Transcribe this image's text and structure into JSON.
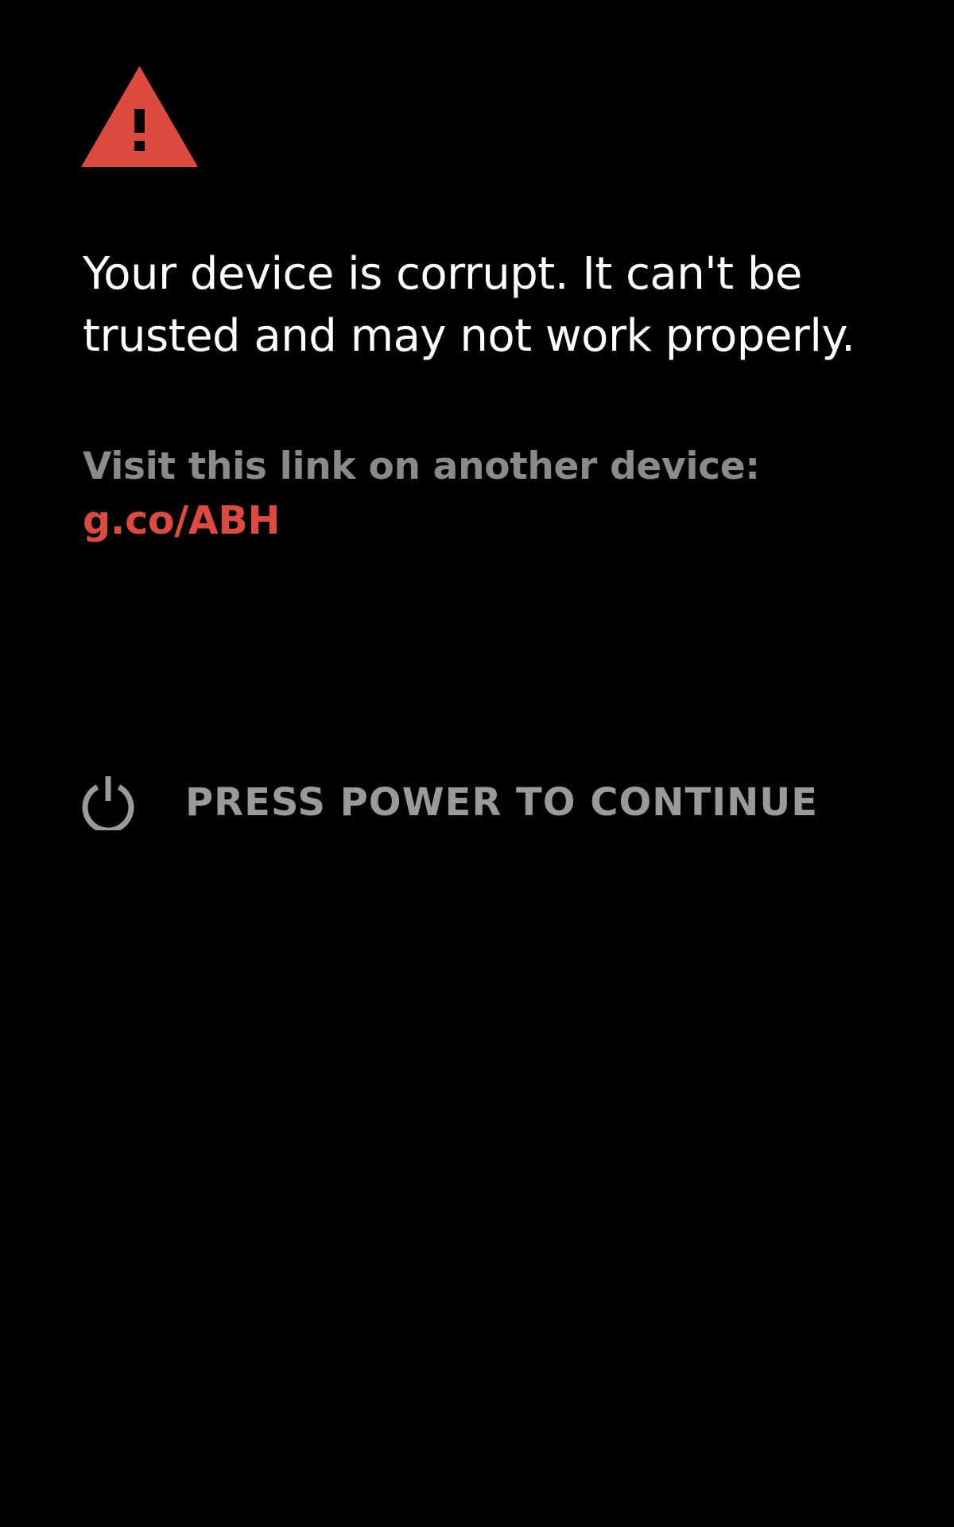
{
  "screen": {
    "background": "#000000",
    "icon": "warning-triangle-icon",
    "icon_color": "#dd4b40"
  },
  "message": {
    "headline": "Your device is corrupt. It can't be trusted and may not work properly.",
    "visit_label": "Visit this link on another device:",
    "link_text": "g.co/ABH",
    "link_color": "#dd4b40"
  },
  "action": {
    "icon": "power-icon",
    "label": "PRESS POWER TO CONTINUE"
  }
}
